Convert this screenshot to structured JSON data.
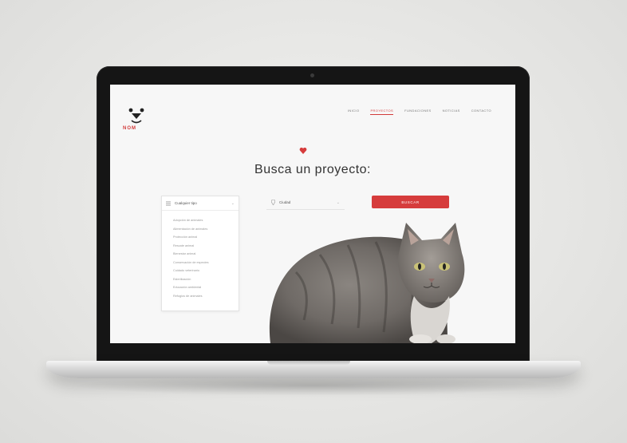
{
  "brand": {
    "name": "NOM",
    "accent": "#d63c3c"
  },
  "nav": {
    "items": [
      "Inicio",
      "Proyectos",
      "Fundaciones",
      "Noticias",
      "Contacto"
    ],
    "active_index": 1
  },
  "hero": {
    "title": "Busca un proyecto:"
  },
  "filters": {
    "category": {
      "selected": "Cualquier tipo",
      "options": [
        "Adopción de animales",
        "Alimentación de animales",
        "Protección animal",
        "Rescate animal",
        "Bienestar animal",
        "Conservación de especies",
        "Cuidado veterinario",
        "Esterilización",
        "Educación ambiental",
        "Refugios de animales"
      ]
    },
    "location": {
      "selected": "Ciudad"
    },
    "search_button": "Buscar"
  },
  "icons": {
    "logo": "bear-face-logo",
    "heart": "heart-icon",
    "pin": "location-pin-icon",
    "list": "list-icon",
    "chevron": "chevron-down-icon"
  }
}
